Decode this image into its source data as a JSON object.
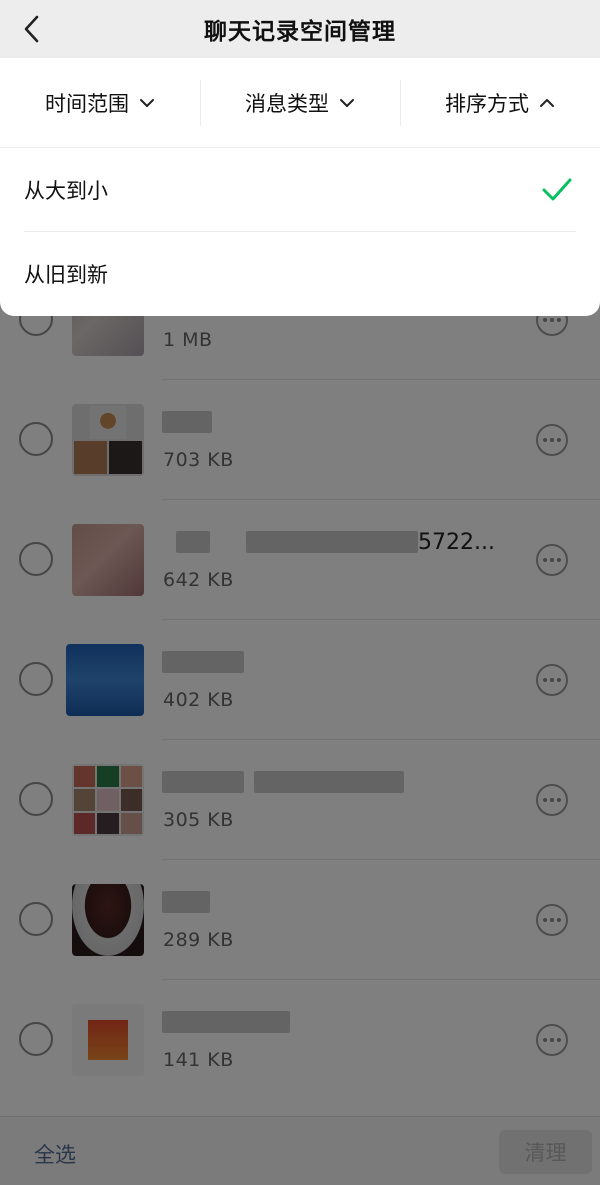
{
  "header": {
    "title": "聊天记录空间管理",
    "back_icon": "chevron-left-icon"
  },
  "filters": [
    {
      "label": "时间范围",
      "icon": "chevron-down-icon"
    },
    {
      "label": "消息类型",
      "icon": "chevron-down-icon"
    },
    {
      "label": "排序方式",
      "icon": "chevron-up-icon"
    }
  ],
  "sort_options": [
    {
      "label": "从大到小",
      "selected": true
    },
    {
      "label": "从旧到新",
      "selected": false
    }
  ],
  "colors": {
    "accent": "#07c160",
    "link": "#576b95"
  },
  "list": {
    "items": [
      {
        "size": "1 MB"
      },
      {
        "size": "703 KB"
      },
      {
        "name_suffix": "5722...",
        "size": "642 KB"
      },
      {
        "size": "402 KB"
      },
      {
        "size": "305 KB"
      },
      {
        "size": "289 KB"
      },
      {
        "size": "141 KB"
      }
    ]
  },
  "bottom": {
    "select_all": "全选",
    "clean": "清理"
  }
}
